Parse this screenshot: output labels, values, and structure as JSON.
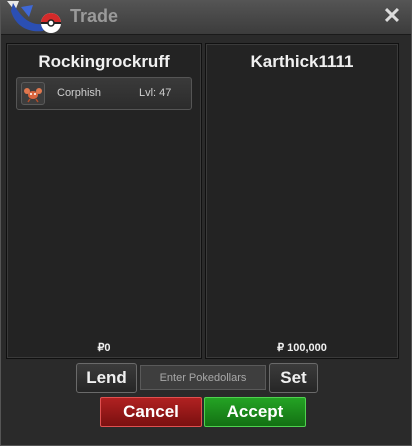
{
  "window": {
    "title": "Trade",
    "close_icon": "close-icon",
    "logo_icon": "pokeball-logo-icon"
  },
  "left_panel": {
    "trainer": "Rockingrockruff",
    "items": [
      {
        "icon": "corphish-sprite-icon",
        "name": "Corphish",
        "level": "Lvl: 47"
      }
    ],
    "money": "₽0"
  },
  "right_panel": {
    "trainer": "Karthick1111",
    "money": "₽ 100,000"
  },
  "controls": {
    "lend_label": "Lend",
    "pokedollars_placeholder": "Enter Pokedollars",
    "set_label": "Set",
    "cancel_label": "Cancel",
    "accept_label": "Accept"
  },
  "colors": {
    "cancel": "#a01c1c",
    "accept": "#1f961f",
    "panel": "#232323"
  }
}
